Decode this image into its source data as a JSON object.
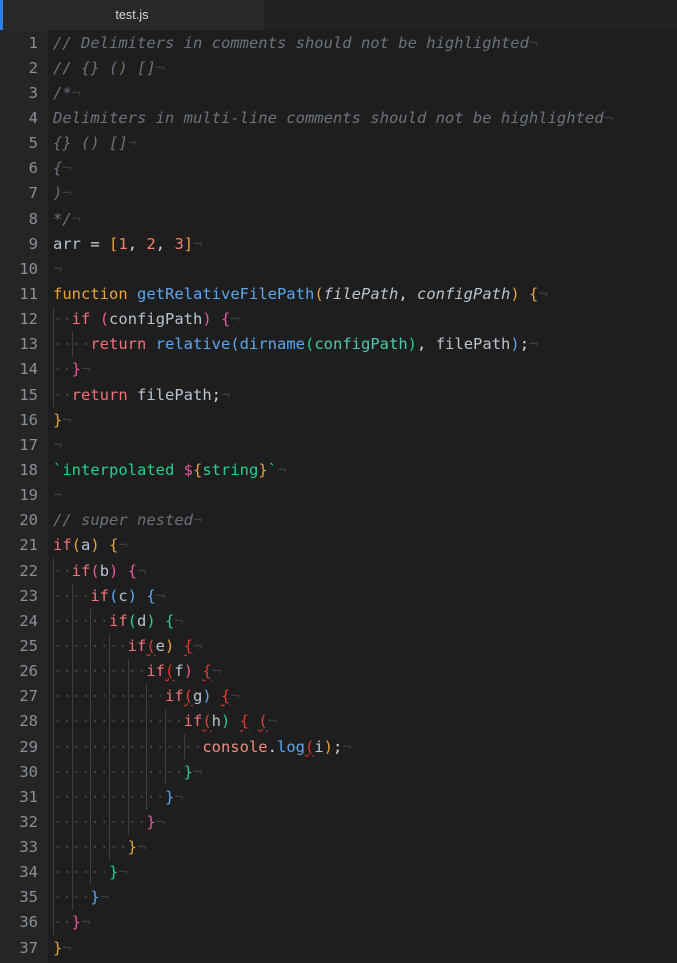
{
  "window": {
    "app": "code-editor",
    "theme_background": "#1e1e1e",
    "gutter_background": "#252526"
  },
  "tabbar": {
    "active_tab": "test.js",
    "active_indicator_color": "#2f7ee0",
    "tab_background": "#282828",
    "bar_background": "#202020"
  },
  "editor": {
    "language": "javascript",
    "line_count": 37,
    "eol_marker": "¬",
    "whitespace_marker": "·",
    "bracket_colors": [
      "#e8a33d",
      "#e75a9b",
      "#5aa7f0",
      "#23d18b"
    ],
    "error_bracket_color": "#e53935",
    "lines": [
      {
        "n": "1",
        "text": "// Delimiters in comments should not be highlighted"
      },
      {
        "n": "2",
        "text": "// {} () []"
      },
      {
        "n": "3",
        "text": "/*"
      },
      {
        "n": "4",
        "text": "Delimiters in multi-line comments should not be highlighted"
      },
      {
        "n": "5",
        "text": "{} () []"
      },
      {
        "n": "6",
        "text": "{"
      },
      {
        "n": "7",
        "text": ")"
      },
      {
        "n": "8",
        "text": "*/"
      },
      {
        "n": "9",
        "text": "arr = [1, 2, 3]"
      },
      {
        "n": "10",
        "text": ""
      },
      {
        "n": "11",
        "text": "function getRelativeFilePath(filePath, configPath) {"
      },
      {
        "n": "12",
        "text": "  if (configPath) {"
      },
      {
        "n": "13",
        "text": "    return relative(dirname(configPath), filePath);"
      },
      {
        "n": "14",
        "text": "  }"
      },
      {
        "n": "15",
        "text": "  return filePath;"
      },
      {
        "n": "16",
        "text": "}"
      },
      {
        "n": "17",
        "text": ""
      },
      {
        "n": "18",
        "text": "`interpolated ${string}`"
      },
      {
        "n": "19",
        "text": ""
      },
      {
        "n": "20",
        "text": "// super nested"
      },
      {
        "n": "21",
        "text": "if(a) {"
      },
      {
        "n": "22",
        "text": "  if(b) {"
      },
      {
        "n": "23",
        "text": "    if(c) {"
      },
      {
        "n": "24",
        "text": "      if(d) {"
      },
      {
        "n": "25",
        "text": "        if(e) {"
      },
      {
        "n": "26",
        "text": "          if(f) {"
      },
      {
        "n": "27",
        "text": "            if(g) {"
      },
      {
        "n": "28",
        "text": "              if(h) { ("
      },
      {
        "n": "29",
        "text": "                console.log(i);"
      },
      {
        "n": "30",
        "text": "              }"
      },
      {
        "n": "31",
        "text": "            }"
      },
      {
        "n": "32",
        "text": "          }"
      },
      {
        "n": "33",
        "text": "        }"
      },
      {
        "n": "34",
        "text": "      }"
      },
      {
        "n": "35",
        "text": "    }"
      },
      {
        "n": "36",
        "text": "  }"
      },
      {
        "n": "37",
        "text": "}"
      }
    ]
  }
}
